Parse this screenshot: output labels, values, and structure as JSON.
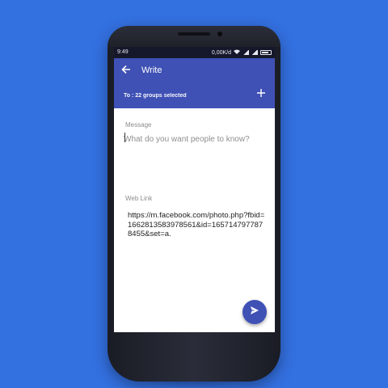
{
  "status_bar": {
    "time": "9:49",
    "network_speed": "0,00K/d"
  },
  "app_bar": {
    "title": "Write",
    "back_icon": "arrow-left-icon",
    "recipients_label": "To : 22 groups selected",
    "add_icon": "plus-icon"
  },
  "form": {
    "message_label": "Message",
    "message_placeholder": "What do you want people to know?",
    "message_value": "",
    "weblink_label": "Web Link",
    "weblink_value": "https://m.facebook.com/photo.php?fbid=1662813583978561&id=1657147977878455&set=a."
  },
  "fab": {
    "icon": "send-icon"
  },
  "colors": {
    "background": "#3370e0",
    "primary": "#3f51b5",
    "status_bar": "#15182a"
  }
}
